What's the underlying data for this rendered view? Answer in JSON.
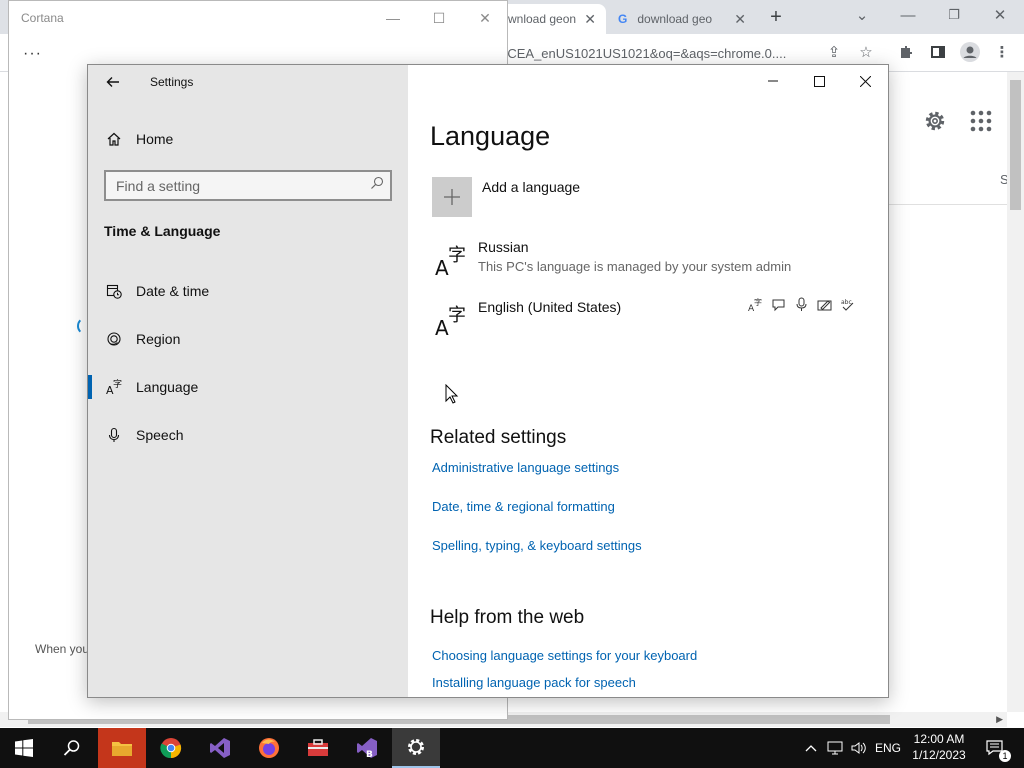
{
  "chrome": {
    "tab1_title": "wnload geon",
    "tab2_title": "download geo",
    "new_tab_symbol": "+",
    "address_text": "1GCEA_enUS1021US1021&oq=&aqs=chrome.0....",
    "partial_right_text": "S"
  },
  "cortana": {
    "title": "Cortana",
    "menu_dots": "···",
    "footer_text": "When you"
  },
  "settings": {
    "window_title": "Settings",
    "home_label": "Home",
    "search_placeholder": "Find a setting",
    "section_title": "Time & Language",
    "nav_items": [
      {
        "label": "Date & time",
        "icon": "calendar-clock-icon"
      },
      {
        "label": "Region",
        "icon": "globe-icon"
      },
      {
        "label": "Language",
        "icon": "language-icon",
        "selected": true
      },
      {
        "label": "Speech",
        "icon": "microphone-icon"
      }
    ],
    "page_title": "Language",
    "add_language_label": "Add a language",
    "languages": [
      {
        "name": "Russian",
        "subtitle": "This PC's language is managed by your system admin"
      },
      {
        "name": "English (United States)",
        "subtitle": ""
      }
    ],
    "related_title": "Related settings",
    "related_links": [
      "Administrative language settings",
      "Date, time & regional formatting",
      "Spelling, typing, & keyboard settings"
    ],
    "help_title": "Help from the web",
    "help_links": [
      "Choosing language settings for your keyboard",
      "Installing language pack for speech"
    ]
  },
  "taskbar": {
    "language": "ENG",
    "time": "12:00 AM",
    "date": "1/12/2023",
    "notification_count": "1",
    "accent": "#0063b1"
  }
}
